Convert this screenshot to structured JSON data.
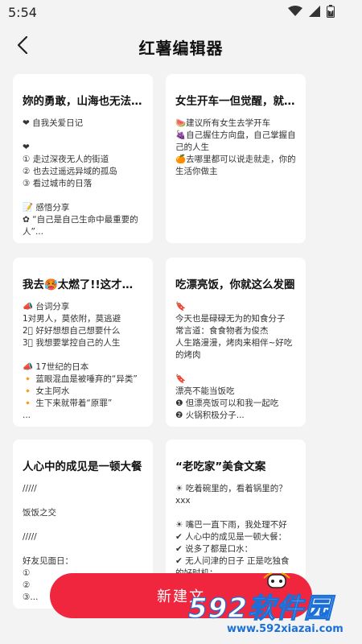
{
  "status": {
    "time": "5:54"
  },
  "header": {
    "title": "红薯编辑器"
  },
  "cards": [
    {
      "title": "妳的勇敢，山海也无法...",
      "lines": [
        "❤ 自我关爱日记",
        "",
        "❤",
        "① 走过深夜无人的街道",
        "② 也去过遥远异域的孤岛",
        "③ 看过城市的日落",
        "",
        "📝 感悟分享",
        "✿ “自己是自己生命中最重要的人”..."
      ]
    },
    {
      "title": "女生开车一但觉醒，就...",
      "lines": [
        "🍉建议所有女生去学开车",
        "🍇自己握住方向盘，自己掌握自己的人生",
        "🍊去哪里都可以说走就走，你的生活你做主"
      ]
    },
    {
      "title": "我去🥵太燃了!!这才是...",
      "lines": [
        "📣 台词分享",
        "1对男人，莫依附，莫逃避",
        "2⃣ 好好想想自己想要什么",
        "3⃣ 我想要掌控自己的人生",
        "",
        "📣 17世纪的日本",
        "🔸 蓝眼混血是被唾弃的“异类”",
        "🔸 女主阿水",
        "🔸 生下来就带着“原罪”",
        "..."
      ]
    },
    {
      "title": "吃漂亮饭，你就这么发圈",
      "lines": [
        "🔖",
        "今天也是碌碌无为的知食分子",
        "常言道：食食物者为俊杰",
        "人生路漫漫，烤肉来相伴~好吃的烤肉",
        "",
        "🔖",
        "漂亮不能当饭吃",
        "❶ 但漂亮饭可以和我一起吃",
        "❷ 火锅积极分子..."
      ]
    },
    {
      "title": "人心中的成见是一顿大餐",
      "lines": [
        "/////",
        "",
        "饭饭之交",
        "",
        "/////",
        "",
        "好友见面日：",
        "①",
        "②",
        "③..."
      ]
    },
    {
      "title": "“老吃家”美食文案",
      "lines": [
        "☀ 吃着碗里的，看着锅里的？",
        "xxx",
        "",
        "☀ 嘴巴一直下雨，我处理不好",
        "✔ 人心中的成见是一顿大餐：",
        "✔ 说多了都是口水：",
        "✔ 无人问津的日子 正是吃独食的好时机："
      ]
    }
  ],
  "new_button": {
    "label": "新建文"
  },
  "watermark": {
    "brand": "592软件园",
    "url": "www.592xiazai.com"
  },
  "colors": {
    "accent": "#f0263e",
    "watermark_blue": "#1a6fd8"
  }
}
